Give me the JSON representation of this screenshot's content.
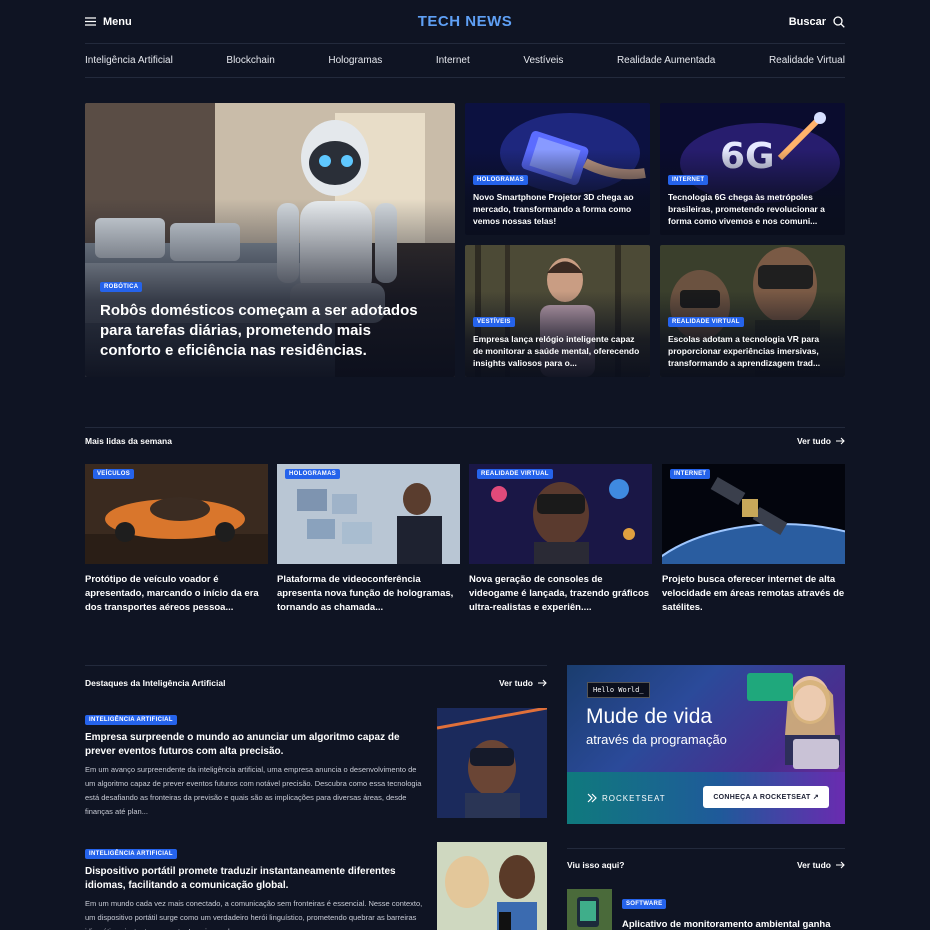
{
  "header": {
    "menu_label": "Menu",
    "logo": "TECH NEWS",
    "search_label": "Buscar"
  },
  "nav": [
    "Inteligência Artificial",
    "Blockchain",
    "Hologramas",
    "Internet",
    "Vestíveis",
    "Realidade Aumentada",
    "Realidade Virtual"
  ],
  "hero": {
    "badge": "Robótica",
    "title": "Robôs domésticos começam a ser adotados para tarefas diárias, prometendo mais conforto e eficiência nas residências."
  },
  "grid": [
    {
      "badge": "Hologramas",
      "title": "Novo Smartphone Projetor 3D chega ao mercado, transformando a forma como vemos nossas telas!"
    },
    {
      "badge": "Internet",
      "title": "Tecnologia 6G chega às metrópoles brasileiras, prometendo revolucionar a forma como vivemos e nos comuni..."
    },
    {
      "badge": "Vestíveis",
      "title": "Empresa lança relógio inteligente capaz de monitorar a saúde mental, oferecendo insights valiosos para o..."
    },
    {
      "badge": "Realidade Virtual",
      "title": "Escolas adotam a tecnologia VR para proporcionar experiências imersivas, transformando a aprendizagem trad..."
    }
  ],
  "most_read": {
    "title": "Mais lidas da semana",
    "see_all": "Ver tudo",
    "items": [
      {
        "badge": "Veículos",
        "title": "Protótipo de veículo voador é apresentado, marcando o início da era dos transportes aéreos pessoa..."
      },
      {
        "badge": "Hologramas",
        "title": "Plataforma de videoconferência apresenta nova função de hologramas, tornando as chamada..."
      },
      {
        "badge": "Realidade Virtual",
        "title": "Nova geração de consoles de videogame é lançada, trazendo gráficos ultra-realistas e experiên...."
      },
      {
        "badge": "Internet",
        "title": "Projeto busca oferecer internet de alta velocidade em áreas remotas através de satélites."
      }
    ]
  },
  "ai_section": {
    "title": "Destaques da Inteligência Artificial",
    "see_all": "Ver tudo",
    "articles": [
      {
        "badge": "Inteligência Artificial",
        "title": "Empresa surpreende o mundo ao anunciar um algoritmo capaz de prever eventos futuros com alta precisão.",
        "excerpt": "Em um avanço surpreendente da inteligência artificial, uma empresa anuncia o desenvolvimento de um algoritmo capaz de prever eventos futuros com notável precisão. Descubra como essa tecnologia está desafiando as fronteiras da previsão e quais são as implicações para diversas áreas, desde finanças até plan..."
      },
      {
        "badge": "Inteligência Artificial",
        "title": "Dispositivo portátil promete traduzir instantaneamente diferentes idiomas, facilitando a comunicação global.",
        "excerpt": "Em um mundo cada vez mais conectado, a comunicação sem fronteiras é essencial. Nesse contexto, um dispositivo portátil surge como um verdadeiro herói linguístico, prometendo quebrar as barreiras idiomáticas instantaneamente. Imagine poder se"
      }
    ]
  },
  "ad": {
    "hello": "Hello World_",
    "headline": "Mude de vida",
    "subline": "através da programação",
    "brand": "ROCKETSEAT",
    "cta": "CONHEÇA A ROCKETSEAT"
  },
  "seen": {
    "title": "Viu isso aqui?",
    "see_all": "Ver tudo",
    "item": {
      "badge": "Software",
      "title": "Aplicativo de monitoramento ambiental ganha destaque, incentivando práticas"
    }
  }
}
